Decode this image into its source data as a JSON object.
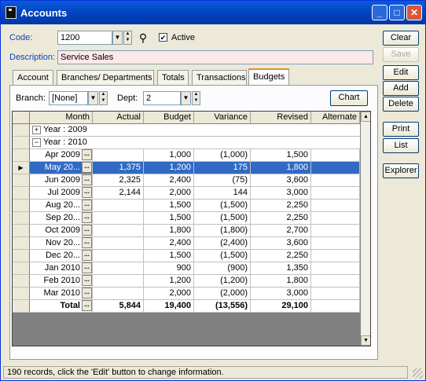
{
  "window": {
    "title": "Accounts"
  },
  "form": {
    "code_label": "Code:",
    "code_value": "1200",
    "active_label": "Active",
    "active_checked": true,
    "description_label": "Description:",
    "description_value": "Service Sales"
  },
  "buttons": {
    "clear": "Clear",
    "save": "Save",
    "edit": "Edit",
    "add": "Add",
    "delete": "Delete",
    "print": "Print",
    "list": "List",
    "explorer": "Explorer",
    "chart": "Chart"
  },
  "tabs": [
    "Account",
    "Branches/ Departments",
    "Totals",
    "Transactions",
    "Budgets"
  ],
  "active_tab": "Budgets",
  "filters": {
    "branch_label": "Branch:",
    "branch_value": "[None]",
    "dept_label": "Dept:",
    "dept_value": "2"
  },
  "grid": {
    "columns": [
      "Month",
      "Actual",
      "Budget",
      "Variance",
      "Revised",
      "Alternate"
    ],
    "groups": [
      {
        "label": "Year : 2009",
        "expanded": false
      },
      {
        "label": "Year : 2010",
        "expanded": true
      }
    ],
    "rows": [
      {
        "month": "Apr 2009",
        "actual": "",
        "budget": "1,000",
        "variance": "(1,000)",
        "revised": "1,500",
        "alternate": ""
      },
      {
        "month": "May 20...",
        "actual": "1,375",
        "budget": "1,200",
        "variance": "175",
        "revised": "1,800",
        "alternate": "",
        "selected": true
      },
      {
        "month": "Jun 2009",
        "actual": "2,325",
        "budget": "2,400",
        "variance": "(75)",
        "revised": "3,600",
        "alternate": ""
      },
      {
        "month": "Jul 2009",
        "actual": "2,144",
        "budget": "2,000",
        "variance": "144",
        "revised": "3,000",
        "alternate": ""
      },
      {
        "month": "Aug 20...",
        "actual": "",
        "budget": "1,500",
        "variance": "(1,500)",
        "revised": "2,250",
        "alternate": ""
      },
      {
        "month": "Sep 20...",
        "actual": "",
        "budget": "1,500",
        "variance": "(1,500)",
        "revised": "2,250",
        "alternate": ""
      },
      {
        "month": "Oct 2009",
        "actual": "",
        "budget": "1,800",
        "variance": "(1,800)",
        "revised": "2,700",
        "alternate": ""
      },
      {
        "month": "Nov 20...",
        "actual": "",
        "budget": "2,400",
        "variance": "(2,400)",
        "revised": "3,600",
        "alternate": ""
      },
      {
        "month": "Dec 20...",
        "actual": "",
        "budget": "1,500",
        "variance": "(1,500)",
        "revised": "2,250",
        "alternate": ""
      },
      {
        "month": "Jan 2010",
        "actual": "",
        "budget": "900",
        "variance": "(900)",
        "revised": "1,350",
        "alternate": ""
      },
      {
        "month": "Feb 2010",
        "actual": "",
        "budget": "1,200",
        "variance": "(1,200)",
        "revised": "1,800",
        "alternate": ""
      },
      {
        "month": "Mar 2010",
        "actual": "",
        "budget": "2,000",
        "variance": "(2,000)",
        "revised": "3,000",
        "alternate": ""
      }
    ],
    "total": {
      "month": "Total",
      "actual": "5,844",
      "budget": "19,400",
      "variance": "(13,556)",
      "revised": "29,100",
      "alternate": ""
    },
    "dots": "...",
    "selected_color": "#316ac5"
  },
  "status": "190 records, click the 'Edit' button to change information.",
  "icons": {
    "binoculars": "binoculars-icon"
  }
}
